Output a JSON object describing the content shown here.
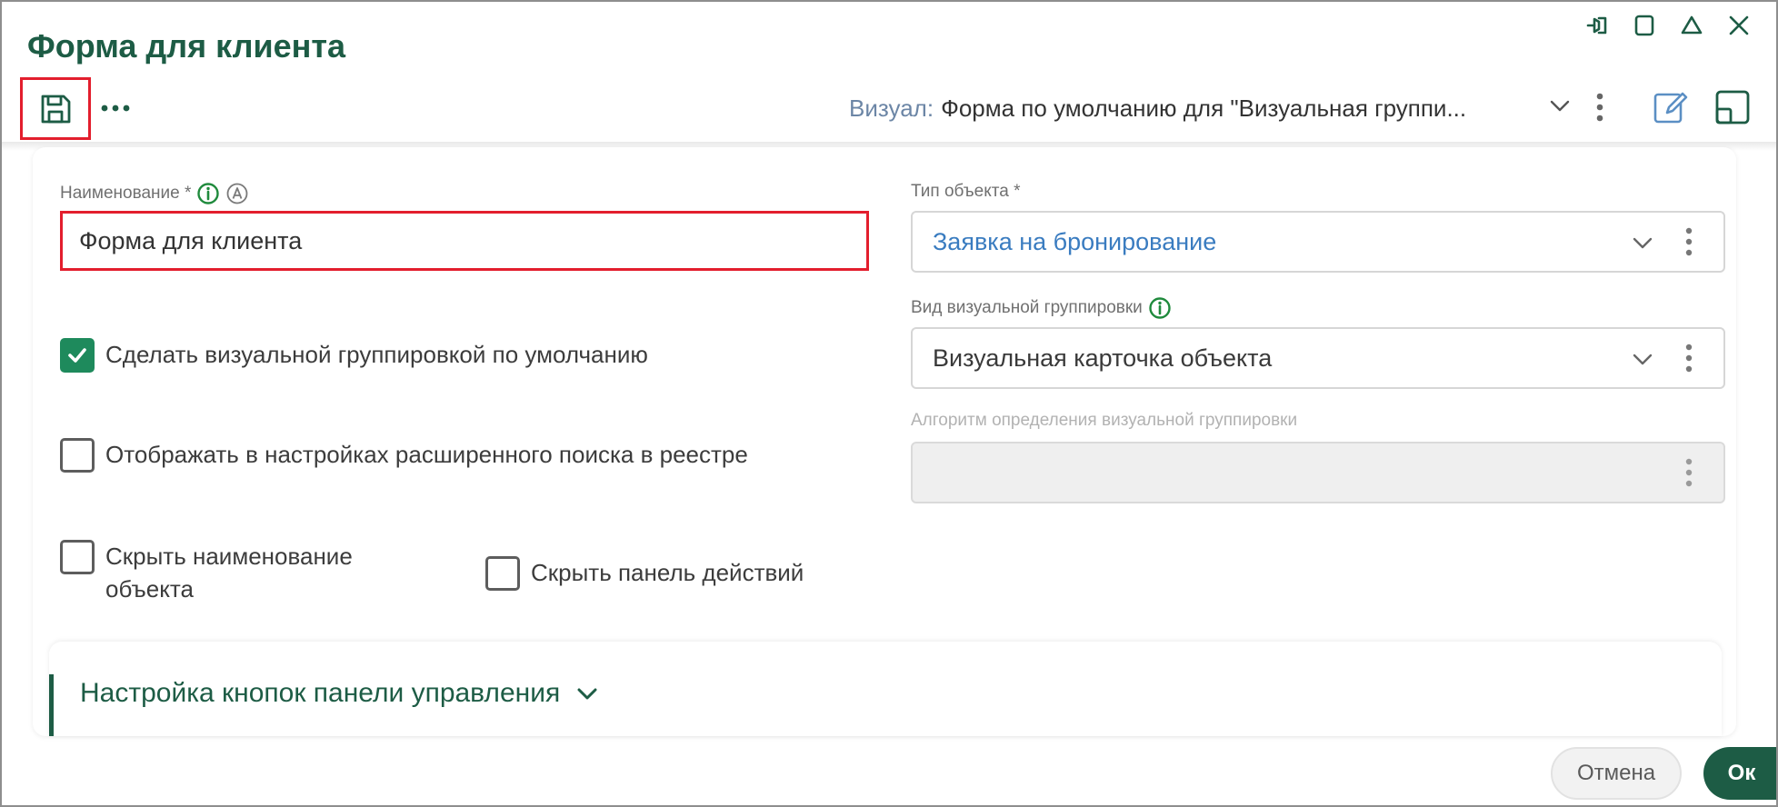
{
  "window": {
    "title": "Форма для клиента",
    "controls": [
      "pin-icon",
      "maximize-icon",
      "collapse-icon",
      "close-icon"
    ]
  },
  "toolbar": {
    "save_icon": "save-icon",
    "more_icon": "more-horizontal-icon",
    "visual_label": "Визуал:",
    "visual_value": "Форма по умолчанию для \"Визуальная группи...",
    "edit_icon": "edit-icon",
    "layout_icon": "layout-icon"
  },
  "form": {
    "name": {
      "label": "Наименование *",
      "value": "Форма для клиента",
      "info_icon": "info-icon",
      "auto_icon": "auto-icon"
    },
    "object_type": {
      "label": "Тип объекта *",
      "value": "Заявка на бронирование"
    },
    "grouping_kind": {
      "label": "Вид визуальной группировки",
      "value": "Визуальная карточка объекта"
    },
    "grouping_algorithm": {
      "label": "Алгоритм определения визуальной группировки",
      "value": ""
    },
    "checkboxes": {
      "default_grouping": {
        "label": "Сделать визуальной группировкой по умолчанию",
        "checked": true
      },
      "show_in_search": {
        "label": "Отображать в настройках расширенного поиска в реестре",
        "checked": false
      },
      "hide_name": {
        "label_line1": "Скрыть наименование",
        "label_line2": "объекта",
        "checked": false
      },
      "hide_actions": {
        "label": "Скрыть панель действий",
        "checked": false
      }
    }
  },
  "section": {
    "title": "Настройка кнопок панели управления"
  },
  "footer": {
    "cancel_label": "Отмена",
    "ok_label": "Ок"
  },
  "colors": {
    "brand": "#1d5c45",
    "highlight": "#e31e2d",
    "link": "#3a7cc0",
    "checkbox_checked": "#1e8a5c",
    "info_green": "#1f8a3c"
  }
}
